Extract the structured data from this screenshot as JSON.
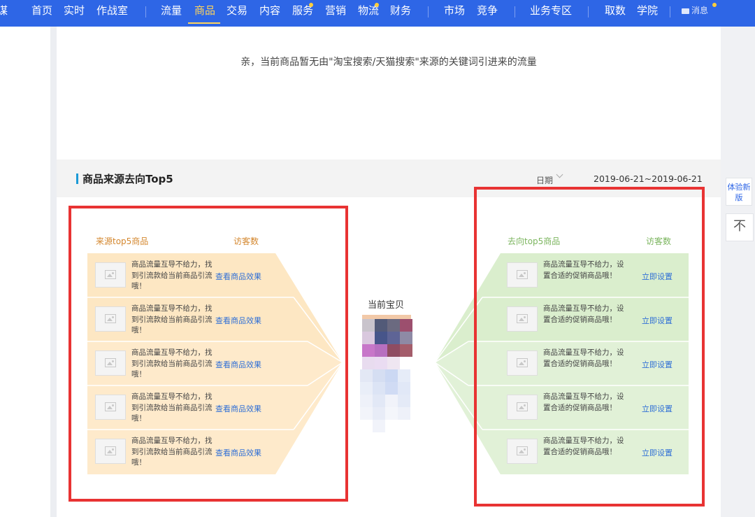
{
  "nav": {
    "items": [
      {
        "label": "谋"
      },
      {
        "label": "首页"
      },
      {
        "label": "实时"
      },
      {
        "label": "作战室"
      },
      {
        "label": "流量"
      },
      {
        "label": "商品",
        "active": true
      },
      {
        "label": "交易"
      },
      {
        "label": "内容"
      },
      {
        "label": "服务",
        "dot": true
      },
      {
        "label": "营销"
      },
      {
        "label": "物流",
        "dot": true
      },
      {
        "label": "财务"
      },
      {
        "label": "市场"
      },
      {
        "label": "竞争"
      },
      {
        "label": "业务专区"
      },
      {
        "label": "取数"
      },
      {
        "label": "学院"
      }
    ],
    "message_label": "消息",
    "accent_color": "#2e66e6",
    "active_color": "#ffd45c"
  },
  "notice": "亲，当前商品暂无由\"淘宝搜索/天猫搜索\"来源的关键词引进来的流量",
  "section": {
    "title": "商品来源去向Top5",
    "date_label": "日期",
    "date_range": "2019-06-21~2019-06-21"
  },
  "source": {
    "header": "来源top5商品",
    "metric_header": "访客数",
    "rows": [
      {
        "text": "商品流量互导不给力，找到引流款给当前商品引流哦！",
        "link": "查看商品效果"
      },
      {
        "text": "商品流量互导不给力，找到引流款给当前商品引流哦！",
        "link": "查看商品效果"
      },
      {
        "text": "商品流量互导不给力，找到引流款给当前商品引流哦！",
        "link": "查看商品效果"
      },
      {
        "text": "商品流量互导不给力，找到引流款给当前商品引流哦！",
        "link": "查看商品效果"
      },
      {
        "text": "商品流量互导不给力，找到引流款给当前商品引流哦！",
        "link": "查看商品效果"
      }
    ],
    "color": "#fde3b8"
  },
  "target": {
    "header": "去向top5商品",
    "metric_header": "访客数",
    "rows": [
      {
        "text": "商品流量互导不给力，设置合适的促销商品哦！",
        "link": "立即设置"
      },
      {
        "text": "商品流量互导不给力，设置合适的促销商品哦！",
        "link": "立即设置"
      },
      {
        "text": "商品流量互导不给力，设置合适的促销商品哦！",
        "link": "立即设置"
      },
      {
        "text": "商品流量互导不给力，设置合适的促销商品哦！",
        "link": "立即设置"
      },
      {
        "text": "商品流量互导不给力，设置合适的促销商品哦！",
        "link": "立即设置"
      }
    ],
    "color": "#d3ebc4"
  },
  "center": {
    "label": "当前宝贝"
  },
  "float_panel": {
    "new_version": "体验新版",
    "back_top": "不"
  }
}
